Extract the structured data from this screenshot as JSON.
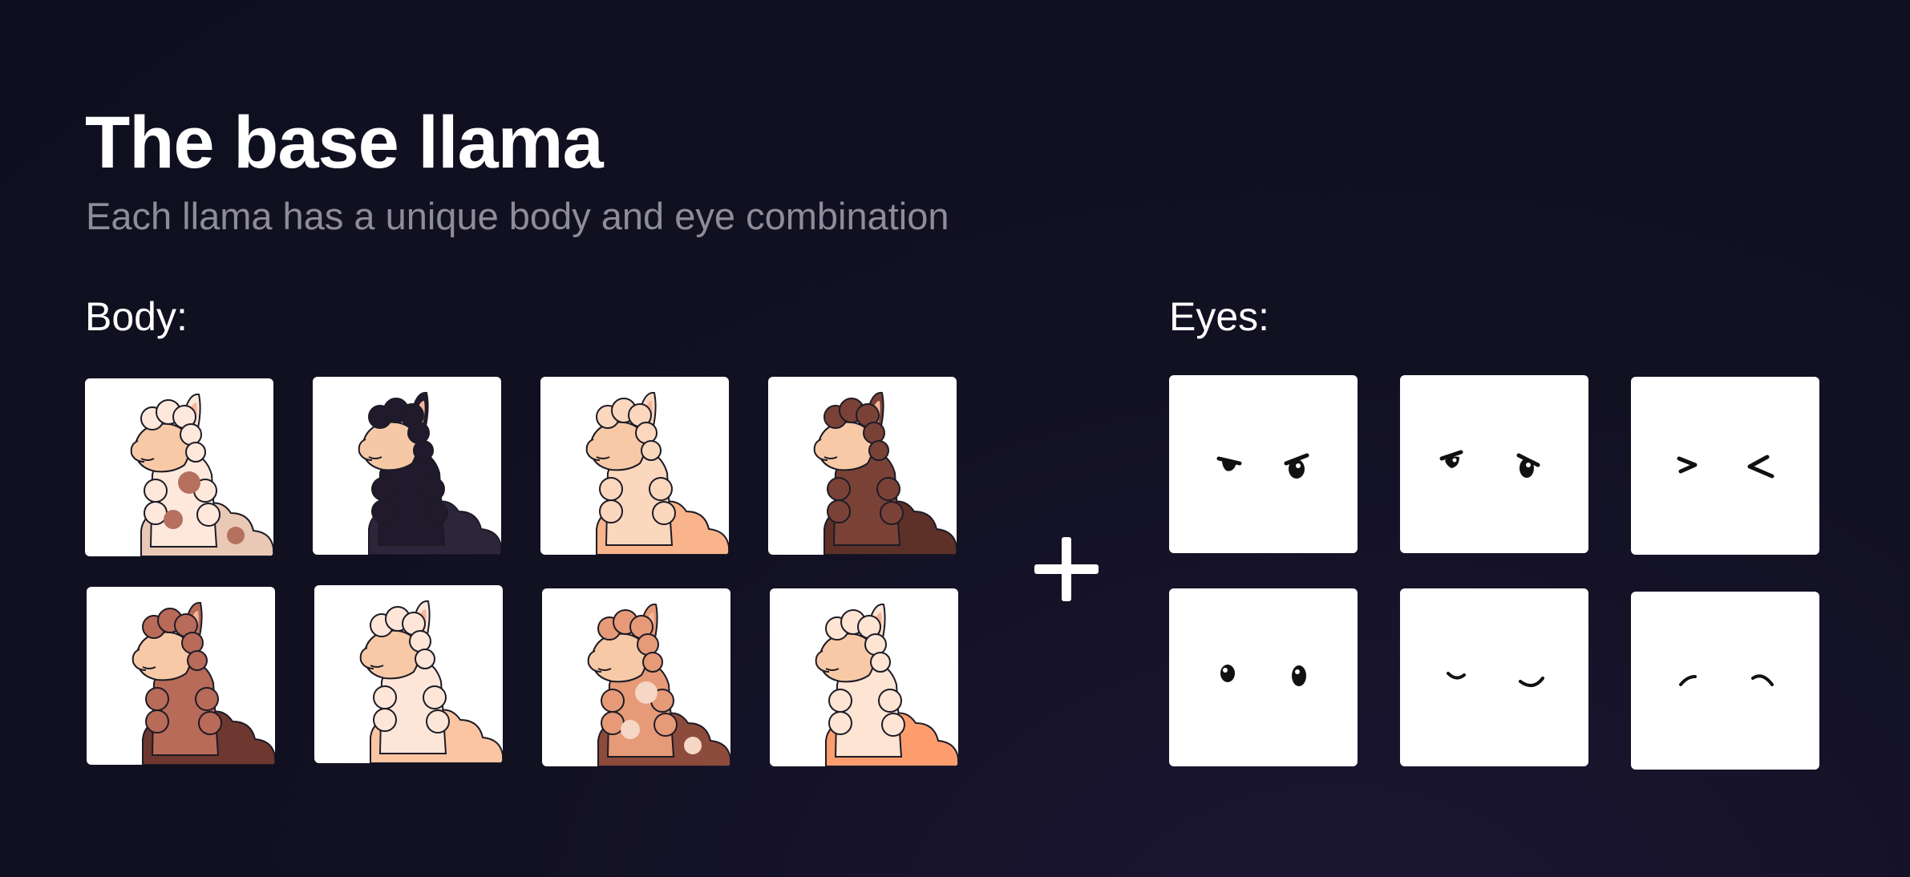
{
  "header": {
    "title": "The base llama",
    "subtitle": "Each llama has a unique body and eye combination"
  },
  "body_section": {
    "label": "Body:",
    "variants": [
      {
        "fur": "#fde8db",
        "fur_shade": "#e9c8b6",
        "spots": "#b5705e",
        "face": "#f7c9a6"
      },
      {
        "fur": "#201a2c",
        "fur_shade": "#2d253a",
        "spots": "",
        "face": "#f6c9a6"
      },
      {
        "fur": "#fbd7bd",
        "fur_shade": "#f9b48b",
        "spots": "",
        "face": "#f7c9a6"
      },
      {
        "fur": "#7a4236",
        "fur_shade": "#5d3128",
        "spots": "",
        "face": "#f7c9a6"
      },
      {
        "fur": "#b86b58",
        "fur_shade": "#6e372f",
        "spots": "",
        "face": "#f7c9a6"
      },
      {
        "fur": "#fde6d8",
        "fur_shade": "#fcc5a2",
        "spots": "",
        "face": "#f7c9a6"
      },
      {
        "fur": "#e69a77",
        "fur_shade": "#8d4b3c",
        "spots": "#f6d6c4",
        "face": "#f7c9a6"
      },
      {
        "fur": "#fde4d3",
        "fur_shade": "#fd9d6e",
        "spots": "",
        "face": "#f7c9a6"
      }
    ]
  },
  "plus_icon": "plus-icon",
  "eyes_section": {
    "label": "Eyes:",
    "variants": [
      "angry-eyes",
      "sceptical-eyes",
      "squinting-eyes",
      "round-eyes",
      "happy-closed-eyes",
      "content-closed-eyes"
    ]
  },
  "colors": {
    "background": "#111122",
    "subtitle": "#8e8c9a",
    "outline": "#1c1b26",
    "ear_inner": "#f6b59a"
  }
}
